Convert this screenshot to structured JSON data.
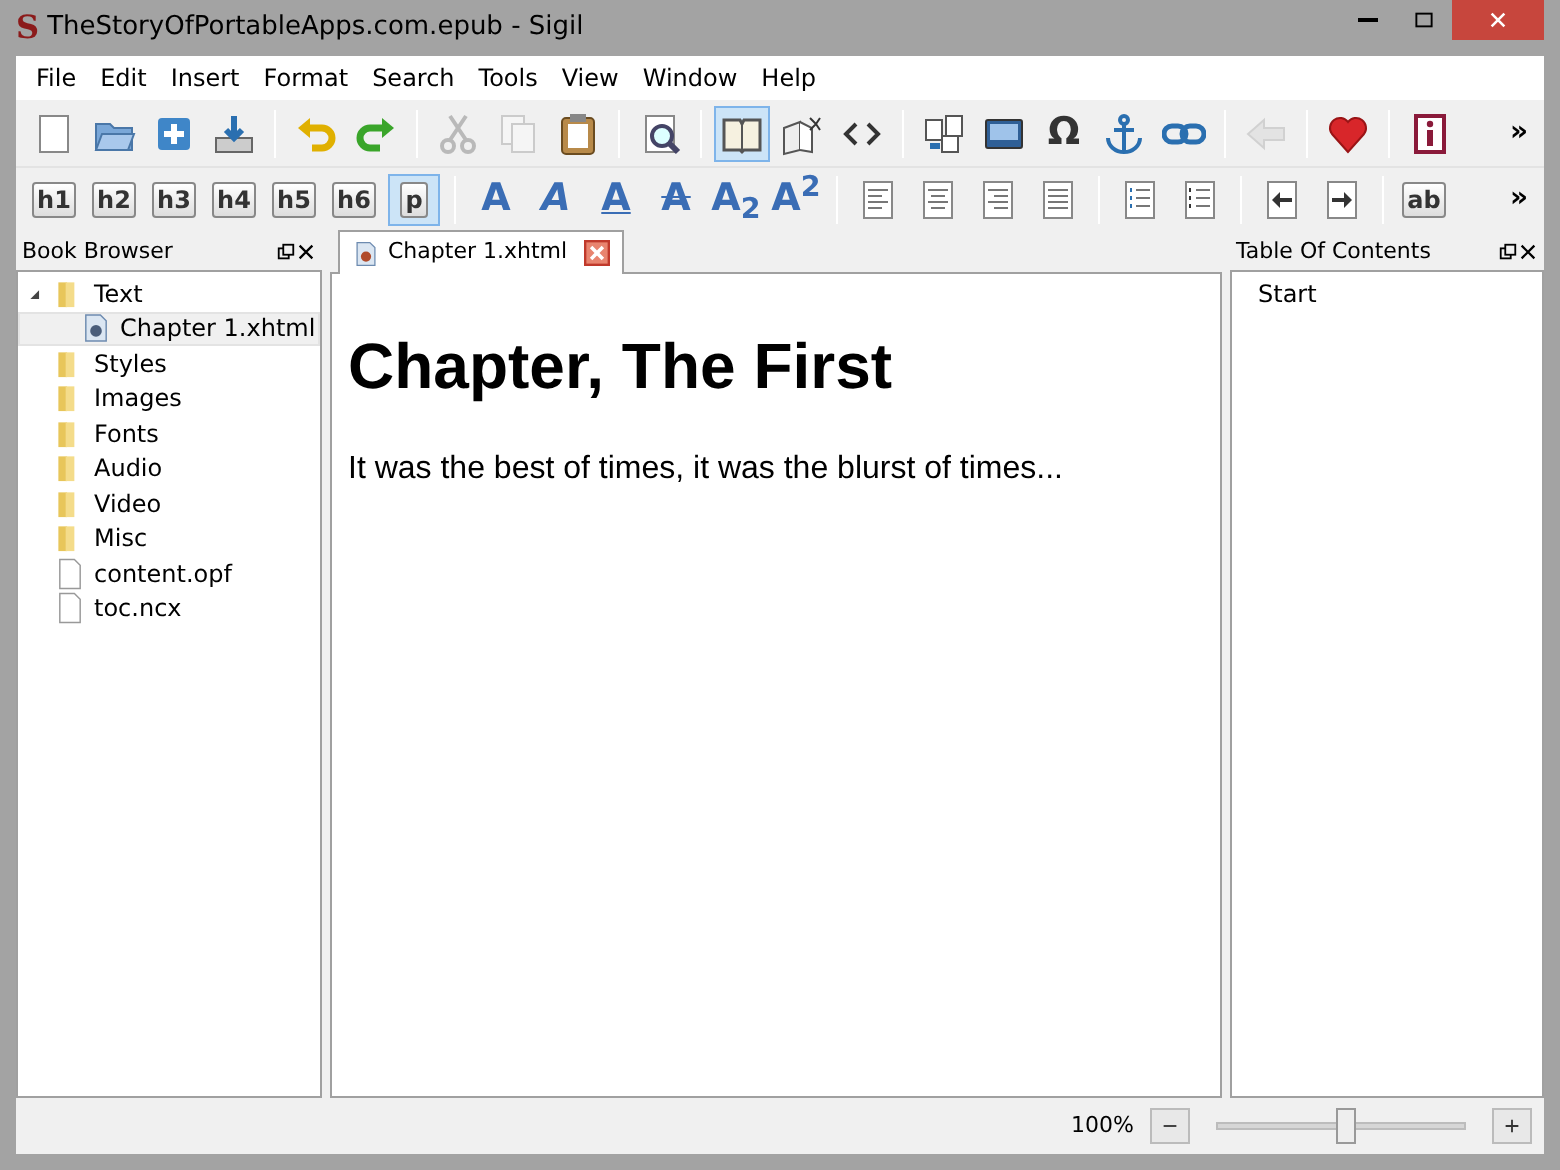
{
  "window": {
    "logo": "S",
    "title": "TheStoryOfPortableApps.com.epub - Sigil"
  },
  "menu": [
    "File",
    "Edit",
    "Insert",
    "Format",
    "Search",
    "Tools",
    "View",
    "Window",
    "Help"
  ],
  "toolbar_1": {
    "groups": [
      [
        {
          "kind": "new",
          "disabled": false
        },
        {
          "kind": "open",
          "disabled": false
        },
        {
          "kind": "add",
          "disabled": false
        },
        {
          "kind": "save",
          "disabled": false
        }
      ],
      [
        {
          "kind": "undo",
          "disabled": false
        },
        {
          "kind": "redo",
          "disabled": false
        }
      ],
      [
        {
          "kind": "cut",
          "disabled": true
        },
        {
          "kind": "copy",
          "disabled": true
        },
        {
          "kind": "paste",
          "disabled": false
        }
      ],
      [
        {
          "kind": "find",
          "disabled": false
        }
      ],
      [
        {
          "kind": "book",
          "disabled": false,
          "selected": true
        },
        {
          "kind": "split",
          "disabled": false,
          "selected": false
        },
        {
          "kind": "code",
          "disabled": false,
          "selected": false
        }
      ],
      [
        {
          "kind": "merge",
          "disabled": false
        },
        {
          "kind": "image",
          "disabled": false
        },
        {
          "kind": "char",
          "label": "Ω",
          "disabled": false
        },
        {
          "kind": "anchor",
          "disabled": false
        },
        {
          "kind": "link",
          "disabled": false
        }
      ],
      [
        {
          "kind": "back",
          "disabled": true
        }
      ],
      [
        {
          "kind": "heart",
          "disabled": false
        }
      ],
      [
        {
          "kind": "info",
          "disabled": false
        }
      ]
    ],
    "overflow": "»"
  },
  "toolbar_2": {
    "headings": [
      {
        "label": "h1",
        "selected": false
      },
      {
        "label": "h2",
        "selected": false
      },
      {
        "label": "h3",
        "selected": false
      },
      {
        "label": "h4",
        "selected": false
      },
      {
        "label": "h5",
        "selected": false
      },
      {
        "label": "h6",
        "selected": false
      },
      {
        "label": "p",
        "selected": true
      }
    ],
    "text_styles": [
      {
        "kind": "bold",
        "label": "A"
      },
      {
        "kind": "italic",
        "label": "A"
      },
      {
        "kind": "underline",
        "label": "A"
      },
      {
        "kind": "strike",
        "label": "A"
      },
      {
        "kind": "sub",
        "label": "A$_{2}$"
      },
      {
        "kind": "sup",
        "label": "A$^{2}$"
      }
    ],
    "groups": [
      [
        {
          "kind": "align-left"
        },
        {
          "kind": "align-center"
        },
        {
          "kind": "align-right"
        },
        {
          "kind": "justify"
        }
      ],
      [
        {
          "kind": "bullets"
        },
        {
          "kind": "numbers"
        }
      ],
      [
        {
          "kind": "outdent"
        },
        {
          "kind": "indent"
        }
      ]
    ],
    "case_button": "ab",
    "overflow": "»"
  },
  "book_browser": {
    "title": "Book Browser",
    "items": [
      {
        "label": "Text",
        "kind": "folder",
        "expanded": true,
        "selected": false,
        "children": [
          {
            "label": "Chapter 1.xhtml",
            "kind": "xhtml",
            "selected": true
          }
        ]
      },
      {
        "label": "Styles",
        "kind": "folder",
        "selected": false
      },
      {
        "label": "Images",
        "kind": "folder",
        "selected": false
      },
      {
        "label": "Fonts",
        "kind": "folder",
        "selected": false
      },
      {
        "label": "Audio",
        "kind": "folder",
        "selected": false
      },
      {
        "label": "Video",
        "kind": "folder",
        "selected": false
      },
      {
        "label": "Misc",
        "kind": "folder",
        "selected": false
      },
      {
        "label": "content.opf",
        "kind": "file",
        "selected": false
      },
      {
        "label": "toc.ncx",
        "kind": "file",
        "selected": false
      }
    ]
  },
  "editor": {
    "tabs": [
      {
        "label": "Chapter 1.xhtml",
        "selected": true
      }
    ],
    "heading": "Chapter, The First",
    "paragraph": "It was the best of times, it was the blurst of times..."
  },
  "table_of_contents": {
    "title": "Table Of Contents",
    "items": [
      "Start"
    ]
  },
  "status_bar": {
    "zoom": "100%",
    "level": 0.48
  }
}
